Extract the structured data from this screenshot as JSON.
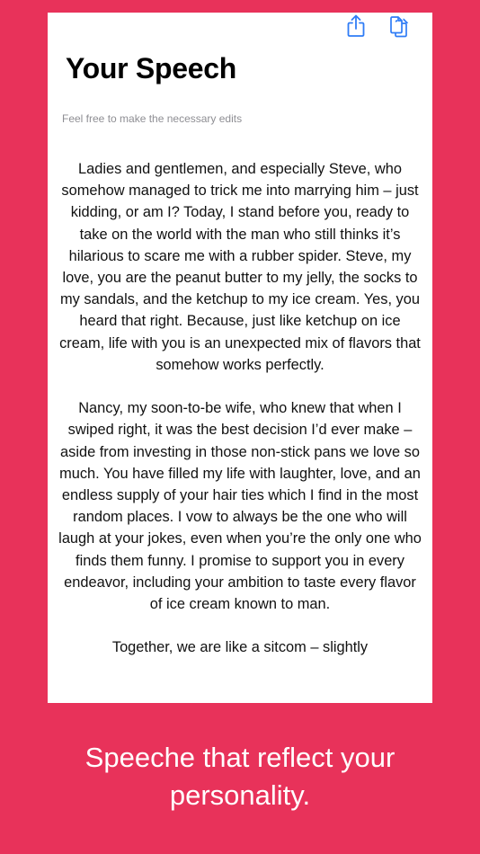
{
  "colors": {
    "background": "#e8325a",
    "card": "#ffffff",
    "accent": "#2f7cf6",
    "caption_text": "#ffffff"
  },
  "toolbar": {
    "share_icon": "share-icon",
    "copy_icon": "copy-icon"
  },
  "header": {
    "title": "Your Speech",
    "subtitle": "Feel free to make the necessary edits"
  },
  "speech": {
    "paragraphs": [
      "Ladies and gentlemen, and especially Steve, who somehow managed to trick me into marrying him – just kidding, or am I? Today, I stand before you, ready to take on the world with the man who still thinks it’s hilarious to scare me with a rubber spider. Steve, my love, you are the peanut butter to my jelly, the socks to my sandals, and the ketchup to my ice cream. Yes, you heard that right. Because, just like ketchup on ice cream, life with you is an unexpected mix of flavors that somehow works perfectly.",
      "Nancy, my soon-to-be wife, who knew that when I swiped right, it was the best decision I’d ever make – aside from investing in those non-stick pans we love so much. You have filled my life with laughter, love, and an endless supply of your hair ties which I find in the most random places. I vow to always be the one who will laugh at your jokes, even when you’re the only one who finds them funny. I promise to support you in every endeavor, including your ambition to taste every flavor of ice cream known to man.",
      "Together, we are like a sitcom – slightly"
    ]
  },
  "caption": {
    "text": "Speeche that reflect your personality."
  }
}
